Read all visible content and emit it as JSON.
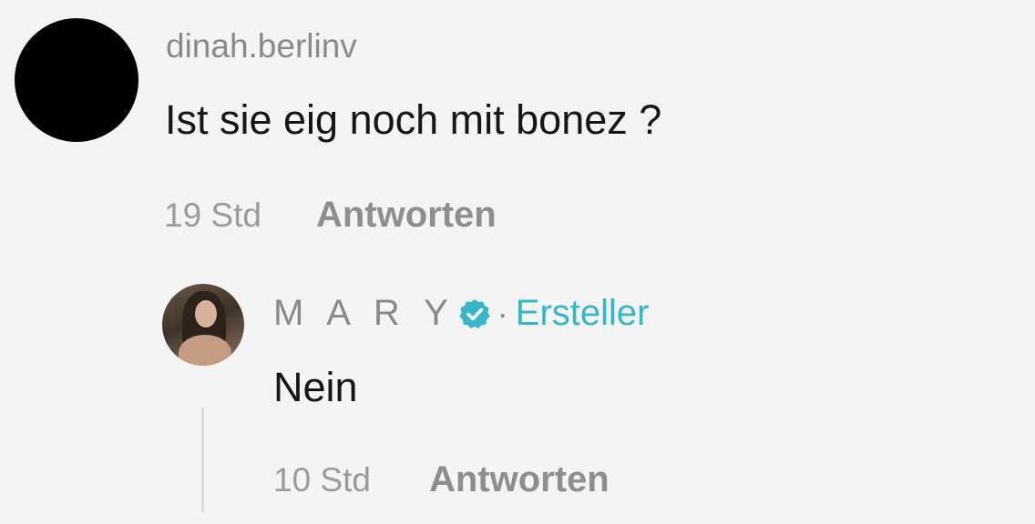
{
  "comment": {
    "username": "dinah.berlinv",
    "text": "Ist sie eig noch mit bonez ?",
    "timestamp": "19 Std",
    "reply_label": "Antworten",
    "avatar_color": "#000000"
  },
  "reply": {
    "username": "M A R Y",
    "verified_icon": "verified-check-icon",
    "separator": "·",
    "creator_label": "Ersteller",
    "text": "Nein",
    "timestamp": "10 Std",
    "reply_label": "Antworten",
    "accent_color": "#38b6c9"
  }
}
